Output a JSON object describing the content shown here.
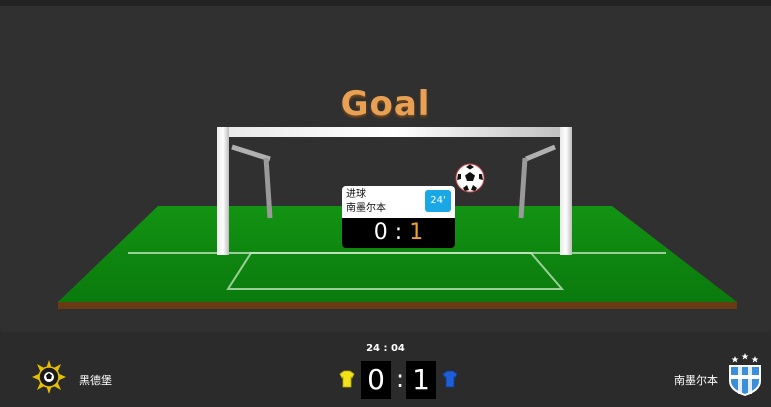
{
  "event": {
    "title": "Goal",
    "type_label": "进球",
    "team_label": "南墨尔本",
    "minute": "24'",
    "score_home": "0",
    "score_sep": ":",
    "score_away": "1"
  },
  "match": {
    "clock": "24 : 04",
    "home": {
      "name": "黑德堡",
      "score": "0",
      "shirt_color": "#f2e21a"
    },
    "away": {
      "name": "南墨尔本",
      "score": "1",
      "shirt_color": "#1f5fd6"
    },
    "separator": ":"
  },
  "colors": {
    "pitch": "#0f8a12",
    "accent": "#f0a030",
    "minute_badge": "#1aa7e6"
  },
  "icons": {
    "ball": "soccer-ball-icon",
    "home_logo": "home-team-crest-icon",
    "away_logo": "away-team-crest-icon"
  }
}
